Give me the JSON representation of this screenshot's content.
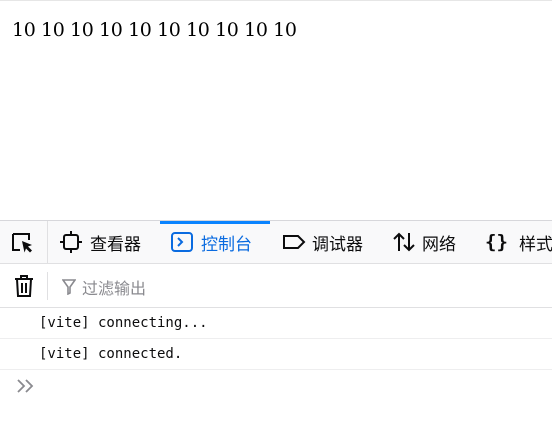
{
  "page": {
    "content_text": "10 10 10 10 10 10 10 10 10 10"
  },
  "devtools": {
    "tabs": [
      {
        "label": "查看器",
        "icon": "inspector-icon"
      },
      {
        "label": "控制台",
        "icon": "console-icon",
        "selected": true
      },
      {
        "label": "调试器",
        "icon": "debugger-icon"
      },
      {
        "label": "网络",
        "icon": "network-icon"
      },
      {
        "label": "样式",
        "icon": "style-editor-icon"
      }
    ],
    "toolbar": {
      "filter_placeholder": "过滤输出"
    },
    "console_messages": [
      "[vite] connecting...",
      "[vite] connected."
    ],
    "accent_color": "#0a84ff"
  }
}
